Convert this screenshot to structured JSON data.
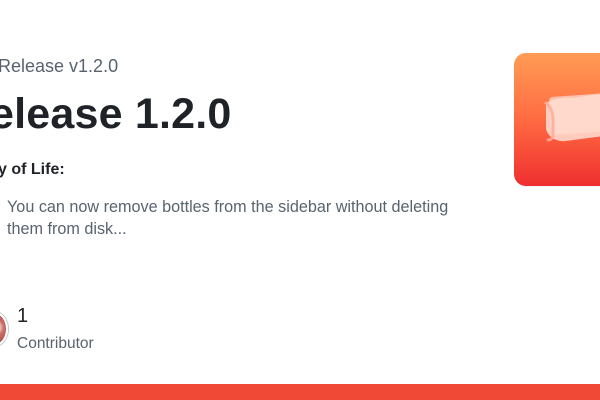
{
  "release": {
    "repo_line": "Release v1.2.0",
    "title": "elease 1.2.0"
  },
  "notes": {
    "heading": "y of Life:",
    "summary": "You can now remove bottles from the sidebar without deleting them from disk..."
  },
  "contributors": {
    "count": "1",
    "label": "Contributor"
  },
  "icons": {
    "repo_image": "orange-app-icon",
    "contributor_avatar": "avatar"
  },
  "colors": {
    "title_text": "#1f2328",
    "muted_text": "#59636e",
    "brand_orange": "#ff7a45",
    "brand_red": "#ef2f2f",
    "bottom_bar": "#f04a36"
  }
}
